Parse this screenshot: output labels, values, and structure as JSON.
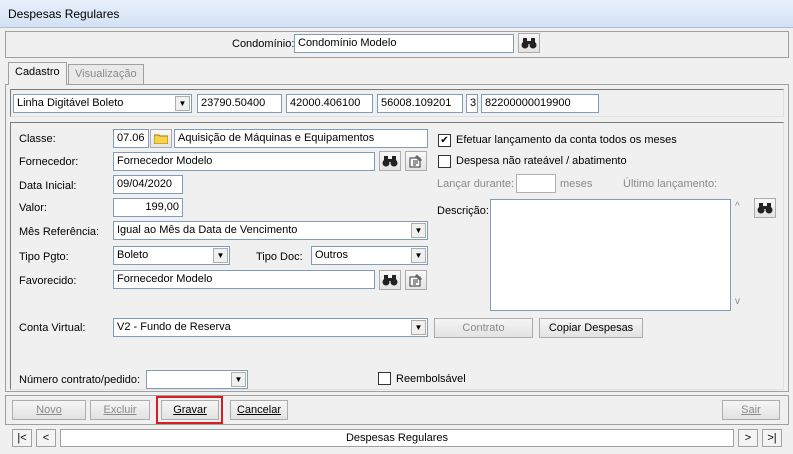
{
  "window": {
    "title": "Despesas Regulares"
  },
  "header": {
    "condominio_label": "Condomínio:",
    "condominio_value": "Condomínio Modelo"
  },
  "tabs": [
    {
      "label": "Cadastro"
    },
    {
      "label": "Visualização"
    }
  ],
  "barcode": {
    "type_value": "Linha Digitável Boleto",
    "part1": "23790.50400",
    "part2": "42000.406100",
    "part3": "56008.109201",
    "part4": "3",
    "part5": "82200000019900"
  },
  "form": {
    "classe_label": "Classe:",
    "classe_code": "07.06",
    "classe_desc": "Aquisição de Máquinas e Equipamentos",
    "fornecedor_label": "Fornecedor:",
    "fornecedor_value": "Fornecedor Modelo",
    "data_inicial_label": "Data Inicial:",
    "data_inicial_value": "09/04/2020",
    "valor_label": "Valor:",
    "valor_value": "199,00",
    "mes_ref_label": "Mês Referência:",
    "mes_ref_value": "Igual ao Mês da Data de Vencimento",
    "tipo_pgto_label": "Tipo Pgto:",
    "tipo_pgto_value": "Boleto",
    "tipo_doc_label": "Tipo Doc:",
    "tipo_doc_value": "Outros",
    "favorecido_label": "Favorecido:",
    "favorecido_value": "Fornecedor Modelo",
    "efetuar_label": "Efetuar lançamento da conta todos os meses",
    "efetuar_checked": true,
    "efetuar_mark": "✔",
    "nao_rateavel_label": "Despesa não rateável / abatimento",
    "lancar_durante_label": "Lançar durante:",
    "meses_label": "meses",
    "ultimo_lancamento_label": "Último lançamento:",
    "descricao_label": "Descrição:",
    "conta_virtual_label": "Conta Virtual:",
    "conta_virtual_value": "V2 - Fundo de Reserva",
    "contrato_button": "Contrato",
    "copiar_button": "Copiar Despesas",
    "numero_contrato_label": "Número contrato/pedido:",
    "reembolsavel_label": "Reembolsável"
  },
  "toolbar": {
    "novo": "Novo",
    "excluir": "Excluir",
    "gravar": "Gravar",
    "cancelar": "Cancelar",
    "sair": "Sair"
  },
  "navigator": {
    "first": "|<",
    "prev": "<",
    "label": "Despesas Regulares",
    "next": ">",
    "last": ">|"
  },
  "icons": {
    "search": "binoculars-icon",
    "register": "register-icon",
    "folder": "folder-icon"
  },
  "colors": {
    "highlight": "#d62020",
    "folder": "#f7d24a"
  }
}
